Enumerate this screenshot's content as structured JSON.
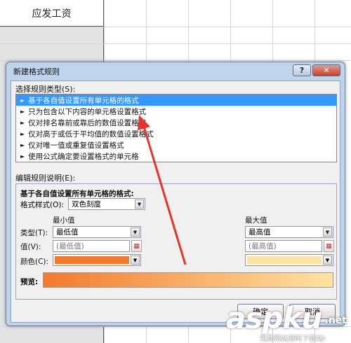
{
  "sheet": {
    "header": "应发工资"
  },
  "dialog": {
    "title": "新建格式规则",
    "help_label": "?",
    "close_label": "✕",
    "rule_type_label": "选择规则类型(S):",
    "rules": [
      "基于各自值设置所有单元格的格式",
      "只为包含以下内容的单元格设置格式",
      "仅对排名靠前或靠后的数值设置格式",
      "仅对高于或低于平均值的数值设置格式",
      "仅对唯一值或重复值设置格式",
      "使用公式确定要设置格式的单元格"
    ],
    "selected_rule_index": 0,
    "edit_label": "编辑规则说明(E):",
    "desc_title": "基于各自值设置所有单元格的格式:",
    "format_style_label": "格式样式(O):",
    "format_style_value": "双色刻度",
    "min_header": "最小值",
    "max_header": "最大值",
    "type_label": "类型(T):",
    "value_label": "值(V):",
    "color_label": "颜色(C):",
    "min_type": "最低值",
    "max_type": "最高值",
    "min_value_placeholder": "(最低值)",
    "max_value_placeholder": "(最高值)",
    "min_color": "#f37a2b",
    "max_color": "#fde3a3",
    "preview_label": "预览:",
    "ok_label": "确定",
    "cancel_label": "取消"
  },
  "watermark": {
    "brand": "aspku",
    "tld": ".net",
    "tagline": "免费网站源码下载站!"
  }
}
